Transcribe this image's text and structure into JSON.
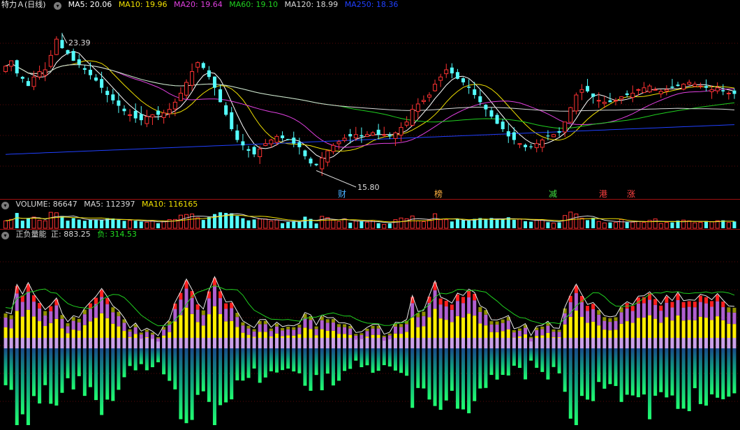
{
  "price_panel": {
    "title": "特力Ａ(日线)",
    "indicators": [
      {
        "label": "MA5: 20.06",
        "color": "#ffffff"
      },
      {
        "label": "MA10: 19.96",
        "color": "#f0e000"
      },
      {
        "label": "MA20: 19.64",
        "color": "#e040e0"
      },
      {
        "label": "MA60: 19.10",
        "color": "#20d020"
      },
      {
        "label": "MA120: 18.99",
        "color": "#d8d8d8"
      },
      {
        "label": "MA250: 18.36",
        "color": "#2040ff"
      }
    ],
    "high_label": "23.39",
    "low_label": "15.80",
    "markers": [
      {
        "label": "财",
        "color": "#4ab0ff"
      },
      {
        "label": "榜",
        "color": "#ffb040"
      },
      {
        "label": "减",
        "color": "#40e040"
      },
      {
        "label": "港",
        "color": "#ff4040"
      },
      {
        "label": "涨",
        "color": "#ff4040"
      }
    ]
  },
  "volume_panel": {
    "indicators": [
      {
        "label": "VOLUME: 86647",
        "color": "#d8d8d8"
      },
      {
        "label": "MA5: 112397",
        "color": "#d8d8d8"
      },
      {
        "label": "MA10: 116165",
        "color": "#f0e000"
      }
    ]
  },
  "energy_panel": {
    "title": "正负量能",
    "indicators": [
      {
        "label": "正: 883.25",
        "color": "#d8d8d8"
      },
      {
        "label": "负: 314.53",
        "color": "#20e020"
      }
    ]
  },
  "chart_data": {
    "type": "candlestick",
    "count": 130,
    "closes": [
      21.6,
      21.9,
      21.2,
      20.9,
      20.5,
      21.0,
      21.3,
      21.4,
      22.2,
      23.1,
      22.6,
      22.3,
      21.9,
      21.7,
      21.4,
      21.1,
      20.8,
      20.4,
      20.0,
      19.7,
      19.4,
      19.1,
      18.9,
      18.7,
      18.6,
      18.8,
      18.9,
      18.9,
      19.0,
      19.2,
      19.6,
      20.1,
      20.7,
      21.3,
      21.8,
      21.5,
      21.0,
      20.4,
      19.6,
      18.9,
      18.1,
      17.5,
      17.2,
      16.9,
      16.7,
      17.0,
      17.3,
      17.5,
      17.7,
      17.6,
      17.5,
      17.3,
      17.1,
      16.6,
      16.2,
      16.1,
      16.5,
      16.9,
      17.2,
      17.4,
      17.6,
      17.7,
      17.8,
      17.7,
      17.8,
      17.9,
      17.8,
      17.8,
      17.7,
      17.9,
      18.2,
      18.5,
      19.2,
      19.5,
      19.7,
      20.0,
      20.6,
      21.0,
      21.4,
      21.2,
      20.9,
      20.7,
      20.4,
      20.0,
      19.6,
      19.2,
      18.8,
      18.4,
      18.1,
      17.7,
      17.5,
      17.3,
      17.1,
      17.1,
      17.3,
      17.5,
      17.7,
      17.8,
      17.9,
      18.5,
      19.3,
      20.0,
      20.3,
      20.2,
      19.9,
      19.7,
      19.6,
      19.6,
      19.7,
      19.9,
      20.0,
      20.1,
      20.3,
      20.4,
      20.5,
      20.3,
      20.2,
      20.3,
      20.4,
      20.5,
      20.6,
      20.7,
      20.6,
      20.5,
      20.4,
      20.3,
      20.4,
      20.2,
      20.1,
      20.06
    ],
    "price_ylim": [
      15.0,
      24.5
    ],
    "high": {
      "index": 10,
      "value": 23.39
    },
    "low": {
      "index": 55,
      "value": 15.8
    }
  }
}
